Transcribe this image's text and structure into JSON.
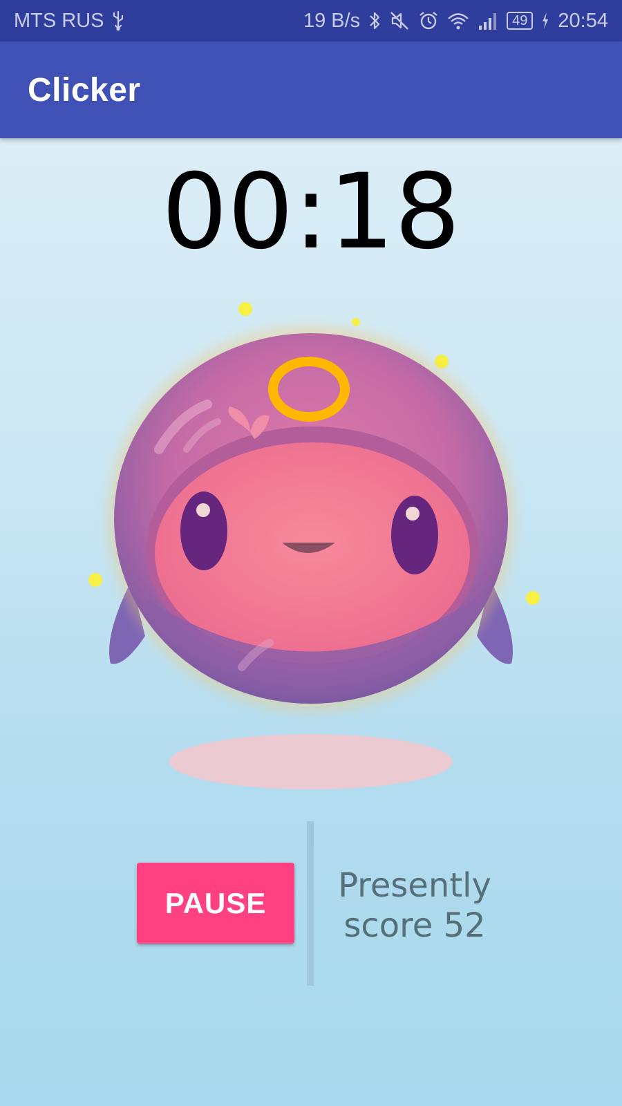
{
  "status_bar": {
    "carrier": "MTS RUS",
    "net_speed": "19 B/s",
    "battery_level": "49",
    "time": "20:54",
    "icons": [
      "usb-icon",
      "bluetooth-icon",
      "mute-icon",
      "alarm-icon",
      "wifi-icon",
      "signal-icon",
      "battery-icon",
      "charging-icon"
    ]
  },
  "app_bar": {
    "title": "Clicker",
    "color": "#3f51b5"
  },
  "game": {
    "timer": "00:18",
    "creature_icon": "pink-creature-character"
  },
  "controls": {
    "pause_label": "PAUSE",
    "pause_color": "#ff4081",
    "score_line1": "Presently",
    "score_line2": "score 52"
  }
}
